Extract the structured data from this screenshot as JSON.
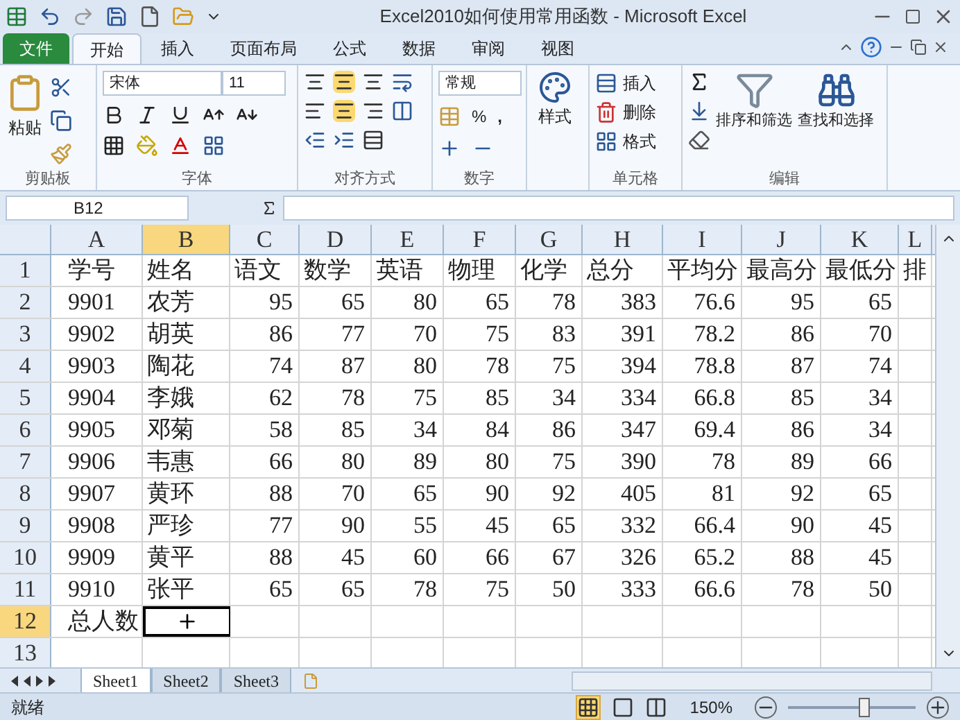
{
  "window": {
    "title": "Excel2010如何使用常用函数 - Microsoft Excel"
  },
  "file_tab": "文件",
  "tabs": [
    {
      "label": "开始",
      "selected": true
    },
    {
      "label": "插入",
      "selected": false
    },
    {
      "label": "页面布局",
      "selected": false
    },
    {
      "label": "公式",
      "selected": false
    },
    {
      "label": "数据",
      "selected": false
    },
    {
      "label": "审阅",
      "selected": false
    },
    {
      "label": "视图",
      "selected": false
    }
  ],
  "ribbon": {
    "clipboard": {
      "label": "剪贴板",
      "paste": "粘贴"
    },
    "font": {
      "label": "字体",
      "font_name": "宋体",
      "font_size": "11"
    },
    "alignment": {
      "label": "对齐方式"
    },
    "number": {
      "label": "数字",
      "format": "常规",
      "percent": "%",
      "comma": ","
    },
    "styles": {
      "label": "样式"
    },
    "cells": {
      "label": "单元格",
      "items": [
        "插入",
        "删除",
        "格式"
      ]
    },
    "editing": {
      "label": "编辑",
      "sort": "排序和筛选",
      "find": "查找和选择"
    }
  },
  "formula_bar": {
    "name_box": "B12"
  },
  "columns": [
    {
      "label": "A",
      "selected": false
    },
    {
      "label": "B",
      "selected": true
    },
    {
      "label": "C",
      "selected": false
    },
    {
      "label": "D",
      "selected": false
    },
    {
      "label": "E",
      "selected": false
    },
    {
      "label": "F",
      "selected": false
    },
    {
      "label": "G",
      "selected": false
    },
    {
      "label": "H",
      "selected": false
    },
    {
      "label": "I",
      "selected": false
    },
    {
      "label": "J",
      "selected": false
    },
    {
      "label": "K",
      "selected": false
    },
    {
      "label": "L",
      "selected": false
    }
  ],
  "rows": [
    {
      "header": "1",
      "selected": false,
      "cells": [
        {
          "t": "学号",
          "kind": "text"
        },
        {
          "t": "姓名",
          "kind": "text"
        },
        {
          "t": "语文",
          "kind": "text"
        },
        {
          "t": "数学",
          "kind": "text"
        },
        {
          "t": "英语",
          "kind": "text"
        },
        {
          "t": "物理",
          "kind": "text"
        },
        {
          "t": "化学",
          "kind": "text"
        },
        {
          "t": "总分",
          "kind": "text"
        },
        {
          "t": "平均分",
          "kind": "text"
        },
        {
          "t": "最高分",
          "kind": "text"
        },
        {
          "t": "最低分",
          "kind": "text"
        },
        {
          "t": "排",
          "kind": "text"
        }
      ]
    },
    {
      "header": "2",
      "selected": false,
      "cells": [
        {
          "t": "9901",
          "kind": "text"
        },
        {
          "t": "农芳",
          "kind": "text"
        },
        {
          "t": "95",
          "kind": "num"
        },
        {
          "t": "65",
          "kind": "num"
        },
        {
          "t": "80",
          "kind": "num"
        },
        {
          "t": "65",
          "kind": "num"
        },
        {
          "t": "78",
          "kind": "num"
        },
        {
          "t": "383",
          "kind": "num"
        },
        {
          "t": "76.6",
          "kind": "num"
        },
        {
          "t": "95",
          "kind": "num"
        },
        {
          "t": "65",
          "kind": "num"
        }
      ]
    },
    {
      "header": "3",
      "selected": false,
      "cells": [
        {
          "t": "9902",
          "kind": "text"
        },
        {
          "t": "胡英",
          "kind": "text"
        },
        {
          "t": "86",
          "kind": "num"
        },
        {
          "t": "77",
          "kind": "num"
        },
        {
          "t": "70",
          "kind": "num"
        },
        {
          "t": "75",
          "kind": "num"
        },
        {
          "t": "83",
          "kind": "num"
        },
        {
          "t": "391",
          "kind": "num"
        },
        {
          "t": "78.2",
          "kind": "num"
        },
        {
          "t": "86",
          "kind": "num"
        },
        {
          "t": "70",
          "kind": "num"
        }
      ]
    },
    {
      "header": "4",
      "selected": false,
      "cells": [
        {
          "t": "9903",
          "kind": "text"
        },
        {
          "t": "陶花",
          "kind": "text"
        },
        {
          "t": "74",
          "kind": "num"
        },
        {
          "t": "87",
          "kind": "num"
        },
        {
          "t": "80",
          "kind": "num"
        },
        {
          "t": "78",
          "kind": "num"
        },
        {
          "t": "75",
          "kind": "num"
        },
        {
          "t": "394",
          "kind": "num"
        },
        {
          "t": "78.8",
          "kind": "num"
        },
        {
          "t": "87",
          "kind": "num"
        },
        {
          "t": "74",
          "kind": "num"
        }
      ]
    },
    {
      "header": "5",
      "selected": false,
      "cells": [
        {
          "t": "9904",
          "kind": "text"
        },
        {
          "t": "李娥",
          "kind": "text"
        },
        {
          "t": "62",
          "kind": "num"
        },
        {
          "t": "78",
          "kind": "num"
        },
        {
          "t": "75",
          "kind": "num"
        },
        {
          "t": "85",
          "kind": "num"
        },
        {
          "t": "34",
          "kind": "num"
        },
        {
          "t": "334",
          "kind": "num"
        },
        {
          "t": "66.8",
          "kind": "num"
        },
        {
          "t": "85",
          "kind": "num"
        },
        {
          "t": "34",
          "kind": "num"
        }
      ]
    },
    {
      "header": "6",
      "selected": false,
      "cells": [
        {
          "t": "9905",
          "kind": "text"
        },
        {
          "t": "邓菊",
          "kind": "text"
        },
        {
          "t": "58",
          "kind": "num"
        },
        {
          "t": "85",
          "kind": "num"
        },
        {
          "t": "34",
          "kind": "num"
        },
        {
          "t": "84",
          "kind": "num"
        },
        {
          "t": "86",
          "kind": "num"
        },
        {
          "t": "347",
          "kind": "num"
        },
        {
          "t": "69.4",
          "kind": "num"
        },
        {
          "t": "86",
          "kind": "num"
        },
        {
          "t": "34",
          "kind": "num"
        }
      ]
    },
    {
      "header": "7",
      "selected": false,
      "cells": [
        {
          "t": "9906",
          "kind": "text"
        },
        {
          "t": "韦惠",
          "kind": "text"
        },
        {
          "t": "66",
          "kind": "num"
        },
        {
          "t": "80",
          "kind": "num"
        },
        {
          "t": "89",
          "kind": "num"
        },
        {
          "t": "80",
          "kind": "num"
        },
        {
          "t": "75",
          "kind": "num"
        },
        {
          "t": "390",
          "kind": "num"
        },
        {
          "t": "78",
          "kind": "num"
        },
        {
          "t": "89",
          "kind": "num"
        },
        {
          "t": "66",
          "kind": "num"
        }
      ]
    },
    {
      "header": "8",
      "selected": false,
      "cells": [
        {
          "t": "9907",
          "kind": "text"
        },
        {
          "t": "黄环",
          "kind": "text"
        },
        {
          "t": "88",
          "kind": "num"
        },
        {
          "t": "70",
          "kind": "num"
        },
        {
          "t": "65",
          "kind": "num"
        },
        {
          "t": "90",
          "kind": "num"
        },
        {
          "t": "92",
          "kind": "num"
        },
        {
          "t": "405",
          "kind": "num"
        },
        {
          "t": "81",
          "kind": "num"
        },
        {
          "t": "92",
          "kind": "num"
        },
        {
          "t": "65",
          "kind": "num"
        }
      ]
    },
    {
      "header": "9",
      "selected": false,
      "cells": [
        {
          "t": "9908",
          "kind": "text"
        },
        {
          "t": "严珍",
          "kind": "text"
        },
        {
          "t": "77",
          "kind": "num"
        },
        {
          "t": "90",
          "kind": "num"
        },
        {
          "t": "55",
          "kind": "num"
        },
        {
          "t": "45",
          "kind": "num"
        },
        {
          "t": "65",
          "kind": "num"
        },
        {
          "t": "332",
          "kind": "num"
        },
        {
          "t": "66.4",
          "kind": "num"
        },
        {
          "t": "90",
          "kind": "num"
        },
        {
          "t": "45",
          "kind": "num"
        }
      ]
    },
    {
      "header": "10",
      "selected": false,
      "cells": [
        {
          "t": "9909",
          "kind": "text"
        },
        {
          "t": "黄平",
          "kind": "text"
        },
        {
          "t": "88",
          "kind": "num"
        },
        {
          "t": "45",
          "kind": "num"
        },
        {
          "t": "60",
          "kind": "num"
        },
        {
          "t": "66",
          "kind": "num"
        },
        {
          "t": "67",
          "kind": "num"
        },
        {
          "t": "326",
          "kind": "num"
        },
        {
          "t": "65.2",
          "kind": "num"
        },
        {
          "t": "88",
          "kind": "num"
        },
        {
          "t": "45",
          "kind": "num"
        }
      ]
    },
    {
      "header": "11",
      "selected": false,
      "cells": [
        {
          "t": "9910",
          "kind": "text"
        },
        {
          "t": "张平",
          "kind": "text"
        },
        {
          "t": "65",
          "kind": "num"
        },
        {
          "t": "65",
          "kind": "num"
        },
        {
          "t": "78",
          "kind": "num"
        },
        {
          "t": "75",
          "kind": "num"
        },
        {
          "t": "50",
          "kind": "num"
        },
        {
          "t": "333",
          "kind": "num"
        },
        {
          "t": "66.6",
          "kind": "num"
        },
        {
          "t": "78",
          "kind": "num"
        },
        {
          "t": "50",
          "kind": "num"
        }
      ]
    },
    {
      "header": "12",
      "selected": true,
      "cells": [
        {
          "t": "总人数",
          "kind": "text"
        }
      ]
    },
    {
      "header": "13",
      "selected": false,
      "cells": []
    }
  ],
  "sheet_tabs": [
    {
      "label": "Sheet1",
      "selected": true
    },
    {
      "label": "Sheet2",
      "selected": false
    },
    {
      "label": "Sheet3",
      "selected": false
    }
  ],
  "status_bar": {
    "status": "就绪",
    "zoom": "150%",
    "zoom_slider": {
      "level": 0.6
    }
  }
}
